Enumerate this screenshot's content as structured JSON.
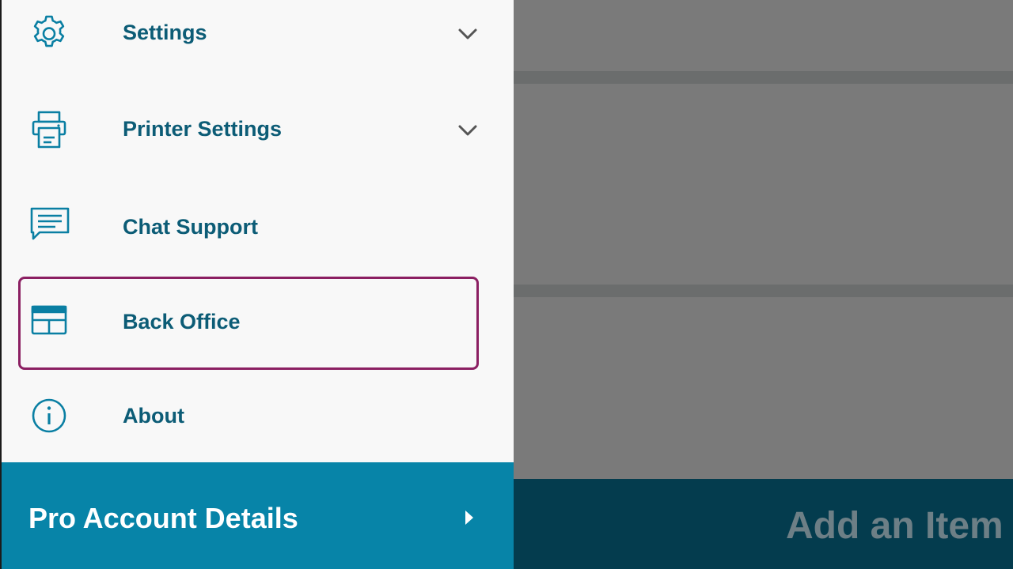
{
  "colors": {
    "drawer_bg": "#f8f8f8",
    "accent_text": "#0c5c76",
    "icon_color": "#0a7fa3",
    "chevron_color": "#555555",
    "highlight_border": "#8b1f62",
    "pro_bar_bg": "#0784a8",
    "backdrop": "#7a7a7a",
    "bottom_bar_bg": "#043c4e"
  },
  "drawer": {
    "items": [
      {
        "label": "Settings",
        "icon": "gear-icon",
        "expandable": true
      },
      {
        "label": "Printer Settings",
        "icon": "printer-icon",
        "expandable": true
      },
      {
        "label": "Chat Support",
        "icon": "chat-icon",
        "expandable": false
      },
      {
        "label": "Back Office",
        "icon": "browser-window-icon",
        "expandable": false,
        "highlighted": true
      },
      {
        "label": "About",
        "icon": "info-icon",
        "expandable": false
      }
    ],
    "pro_account": {
      "label": "Pro Account Details",
      "icon": "caret-right-icon"
    }
  },
  "background": {
    "bottom_bar_text": "Add an Item"
  }
}
